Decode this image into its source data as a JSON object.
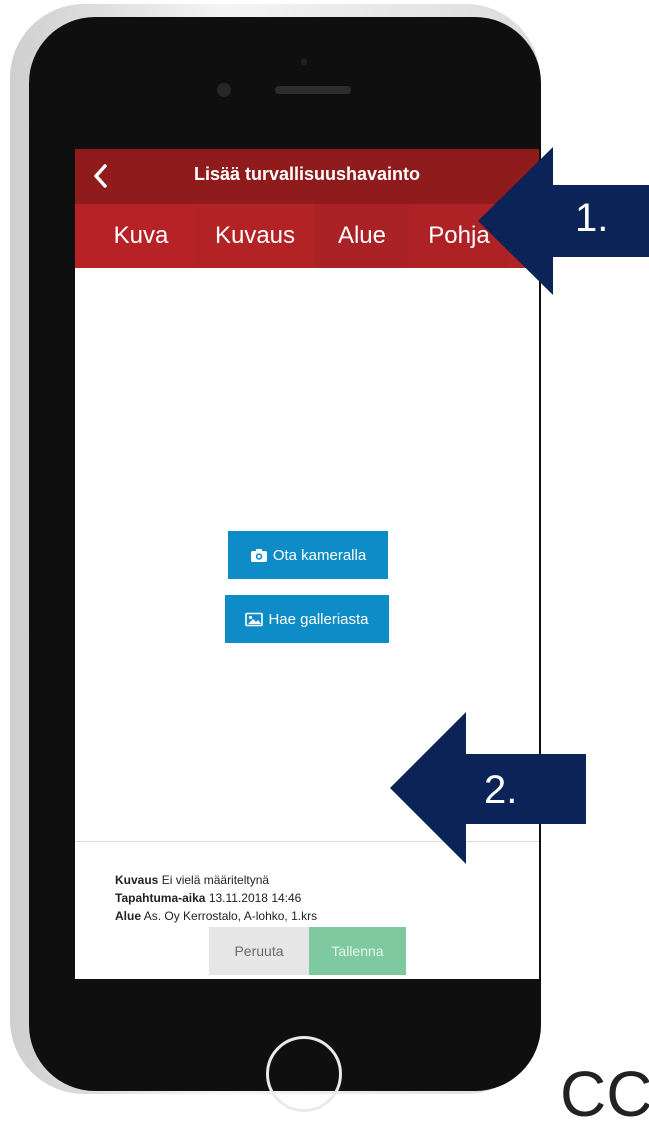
{
  "header": {
    "title": "Lisää turvallisuushavainto",
    "back_icon": "chevron-left-icon"
  },
  "tabs": [
    {
      "label": "Kuva"
    },
    {
      "label": "Kuvaus"
    },
    {
      "label": "Alue"
    },
    {
      "label": "Pohja"
    }
  ],
  "actions": {
    "camera_label": "Ota kameralla",
    "camera_icon": "camera-icon",
    "gallery_label": "Hae galleriasta",
    "gallery_icon": "image-icon"
  },
  "summary": {
    "description_label": "Kuvaus",
    "description_value": "Ei vielä määriteltynä",
    "time_label": "Tapahtuma-aika",
    "time_value": "13.11.2018 14:46",
    "area_label": "Alue",
    "area_value": "As. Oy Kerrostalo, A-lohko, 1.krs"
  },
  "footer": {
    "cancel_label": "Peruuta",
    "save_label": "Tallenna"
  },
  "callouts": [
    {
      "label": "1."
    },
    {
      "label": "2."
    }
  ],
  "corner_text": "CC",
  "colors": {
    "header": "#8f1b1d",
    "tab_bar": "#a92024",
    "primary_button": "#0e8cc8",
    "save_button": "#7fc9a0",
    "cancel_button": "#e6e6e6",
    "callout": "#0b2356"
  }
}
